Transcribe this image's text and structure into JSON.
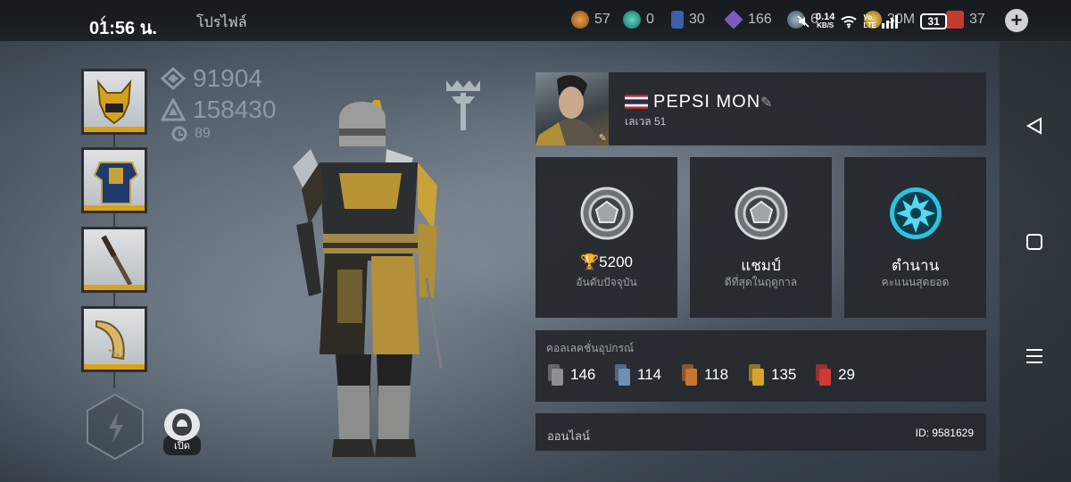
{
  "status_bar": {
    "time": "01:56 น.",
    "net_speed": "0.14",
    "net_unit": "KB/S",
    "volte": "Vo LTE",
    "battery": "31"
  },
  "header": {
    "back_icon": "back-arrow-icon",
    "title": "โปรไฟล์"
  },
  "currencies": [
    {
      "icon": "coin-icon",
      "value": "57",
      "color": "#c47a2c"
    },
    {
      "icon": "gem-icon",
      "value": "0",
      "color": "#2aa89b"
    },
    {
      "icon": "card-icon",
      "value": "30",
      "color": "#3b5fa8"
    },
    {
      "icon": "crystal-icon",
      "value": "166",
      "color": "#7a5bbf"
    },
    {
      "icon": "time-shard-icon",
      "value": "6",
      "color": "#6e8a99"
    },
    {
      "icon": "gold-icon",
      "value": "30M",
      "color": "#d2a92a"
    },
    {
      "icon": "ruby-icon",
      "value": "37",
      "color": "#c23b33"
    }
  ],
  "left": {
    "power_value": "91904",
    "power2_value": "158430",
    "level_value": "89",
    "open_label": "เปิด"
  },
  "profile": {
    "name": "PEPSI   MON",
    "level_label": "เลเวล 51"
  },
  "ranks": [
    {
      "value": "5200",
      "sub": "อันดับปัจจุบัน",
      "has_trophy": true
    },
    {
      "value": "แชมป์",
      "sub": "ดีที่สุดในฤดูกาล",
      "has_trophy": false
    },
    {
      "value": "ตำนาน",
      "sub": "คะแนนสุดยอด",
      "has_trophy": false
    }
  ],
  "collection": {
    "title": "คอลเลคชั่นอุปกรณ์",
    "items": [
      {
        "value": "146",
        "color": "#8c9095"
      },
      {
        "value": "114",
        "color": "#6f8fb8"
      },
      {
        "value": "118",
        "color": "#c8752d"
      },
      {
        "value": "135",
        "color": "#d7a427"
      },
      {
        "value": "29",
        "color": "#cf3a33"
      }
    ]
  },
  "footer": {
    "online": "ออนไลน์",
    "player_id": "ID: 9581629"
  }
}
